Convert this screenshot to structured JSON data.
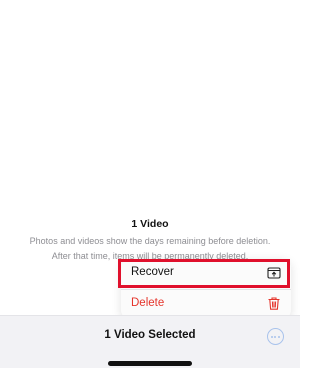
{
  "info": {
    "title": "1 Video",
    "line1": "Photos and videos show the days remaining before deletion.",
    "line2": "After that time, items will be permanently deleted."
  },
  "menu": {
    "recover_label": "Recover",
    "recover_icon": "recover-tray-icon",
    "delete_label": "Delete",
    "delete_icon": "trash-icon"
  },
  "toolbar": {
    "title": "1 Video Selected",
    "more_icon": "ellipsis-circle-icon"
  },
  "colors": {
    "destructive": "#e5342b",
    "highlight": "#e0102c",
    "accent": "#a9c3ec",
    "secondary_text": "#8e8e93"
  }
}
